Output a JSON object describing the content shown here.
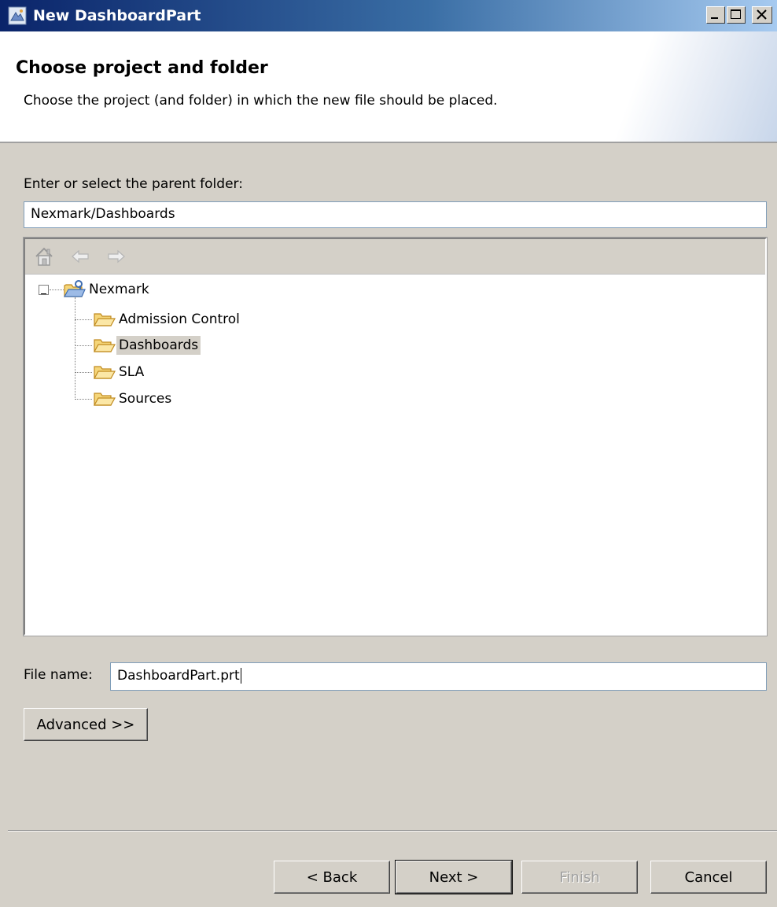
{
  "window": {
    "title": "New DashboardPart",
    "controls": {
      "minimize": "minimize",
      "maximize": "maximize",
      "close": "close"
    }
  },
  "banner": {
    "title": "Choose project and folder",
    "description": "Choose the project (and folder) in which the new file should be placed."
  },
  "parent_folder": {
    "label": "Enter or select the parent folder:",
    "value": "Nexmark/Dashboards"
  },
  "tree": {
    "toolbar": {
      "home": "home-icon",
      "back": "back-arrow-icon",
      "forward": "forward-arrow-icon"
    },
    "root": {
      "label": "Nexmark",
      "expanded": true
    },
    "children": [
      {
        "label": "Admission Control",
        "selected": false
      },
      {
        "label": "Dashboards",
        "selected": true
      },
      {
        "label": "SLA",
        "selected": false
      },
      {
        "label": "Sources",
        "selected": false
      }
    ]
  },
  "file_name": {
    "label": "File name:",
    "value": "DashboardPart.prt"
  },
  "buttons": {
    "advanced": "Advanced >>",
    "back": "< Back",
    "next": "Next >",
    "finish": "Finish",
    "cancel": "Cancel"
  },
  "colors": {
    "dialog_bg": "#d4d0c8",
    "title_gradient_start": "#0a246a",
    "title_gradient_end": "#a6caf0",
    "folder_fill": "#f5d67a",
    "folder_stroke": "#c08a1e"
  }
}
